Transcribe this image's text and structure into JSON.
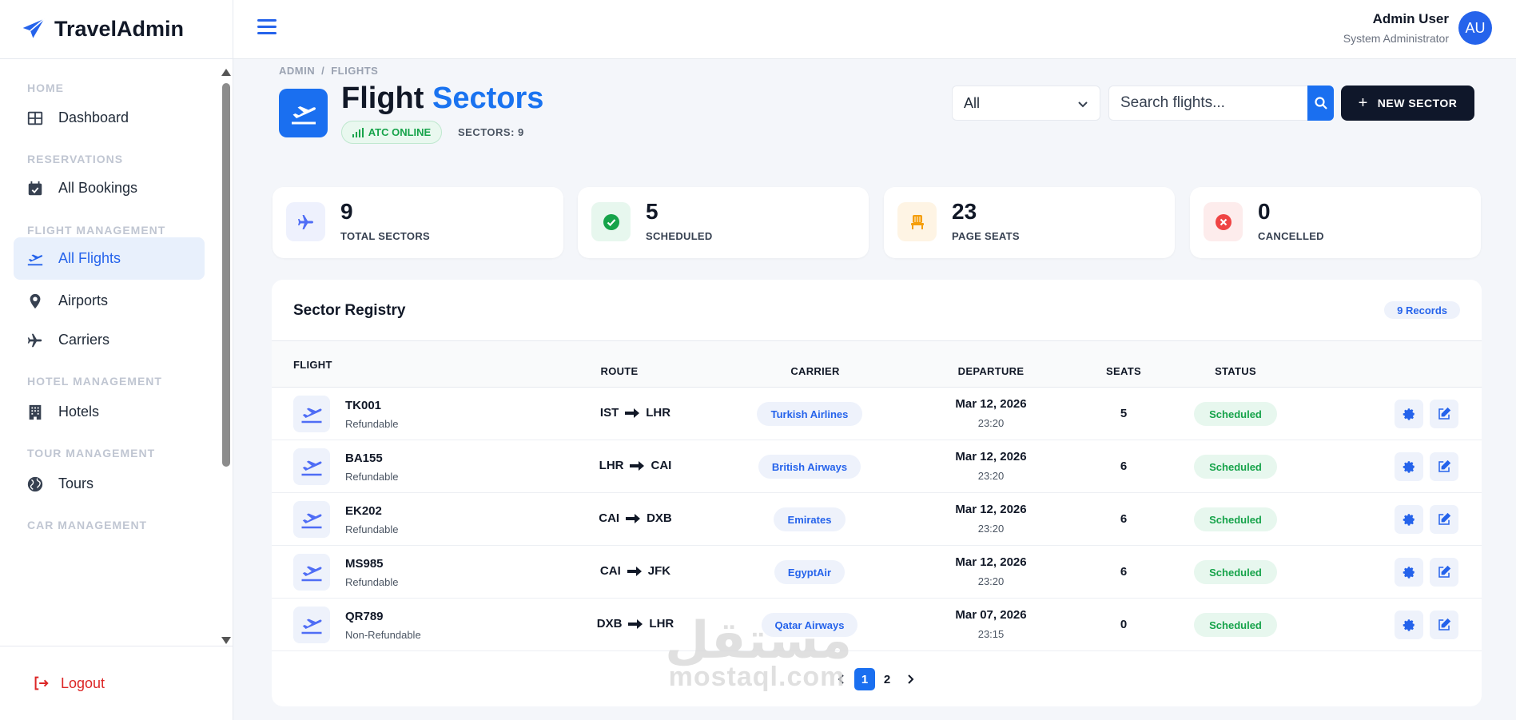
{
  "brand": {
    "name": "TravelAdmin"
  },
  "user": {
    "name": "Admin User",
    "role": "System Administrator",
    "initials": "AU"
  },
  "sidebar": {
    "sections": [
      {
        "label": "HOME"
      },
      {
        "label": "RESERVATIONS"
      },
      {
        "label": "FLIGHT MANAGEMENT"
      },
      {
        "label": "HOTEL MANAGEMENT"
      },
      {
        "label": "TOUR MANAGEMENT"
      },
      {
        "label": "CAR MANAGEMENT"
      }
    ],
    "items": [
      {
        "label": "Dashboard",
        "icon": "grid-icon"
      },
      {
        "label": "All Bookings",
        "icon": "calendar-check-icon"
      },
      {
        "label": "All Flights",
        "icon": "plane-departure-icon",
        "active": true
      },
      {
        "label": "Airports",
        "icon": "map-pin-icon"
      },
      {
        "label": "Carriers",
        "icon": "plane-icon"
      },
      {
        "label": "Hotels",
        "icon": "building-icon"
      },
      {
        "label": "Tours",
        "icon": "globe-icon"
      }
    ],
    "logout_label": "Logout"
  },
  "breadcrumb": {
    "root": "ADMIN",
    "sep": "/",
    "current": "FLIGHTS"
  },
  "page": {
    "title_main": "Flight",
    "title_accent": "Sectors",
    "atc_status": "ATC ONLINE",
    "sector_count": "SECTORS: 9"
  },
  "filter": {
    "selected": "All"
  },
  "search": {
    "placeholder": "Search flights..."
  },
  "new_button_label": "NEW SECTOR",
  "stats": [
    {
      "value": "9",
      "label": "TOTAL SECTORS",
      "icon": "plane-icon",
      "color": "#4f6df5"
    },
    {
      "value": "5",
      "label": "SCHEDULED",
      "icon": "check-circle-icon",
      "color": "#16a34a"
    },
    {
      "value": "23",
      "label": "PAGE SEATS",
      "icon": "seat-icon",
      "color": "#f59e0b"
    },
    {
      "value": "0",
      "label": "CANCELLED",
      "icon": "x-circle-icon",
      "color": "#ef4444"
    }
  ],
  "table": {
    "title": "Sector Registry",
    "records": "9 Records",
    "columns": [
      "FLIGHT",
      "ROUTE",
      "CARRIER",
      "DEPARTURE",
      "SEATS",
      "STATUS"
    ],
    "rows": [
      {
        "code": "TK001",
        "type": "Refundable",
        "from": "IST",
        "to": "LHR",
        "carrier": "Turkish Airlines",
        "date": "Mar 12, 2026",
        "time": "23:20",
        "seats": "5",
        "status": "Scheduled"
      },
      {
        "code": "BA155",
        "type": "Refundable",
        "from": "LHR",
        "to": "CAI",
        "carrier": "British Airways",
        "date": "Mar 12, 2026",
        "time": "23:20",
        "seats": "6",
        "status": "Scheduled"
      },
      {
        "code": "EK202",
        "type": "Refundable",
        "from": "CAI",
        "to": "DXB",
        "carrier": "Emirates",
        "date": "Mar 12, 2026",
        "time": "23:20",
        "seats": "6",
        "status": "Scheduled"
      },
      {
        "code": "MS985",
        "type": "Refundable",
        "from": "CAI",
        "to": "JFK",
        "carrier": "EgyptAir",
        "date": "Mar 12, 2026",
        "time": "23:20",
        "seats": "6",
        "status": "Scheduled"
      },
      {
        "code": "QR789",
        "type": "Non-Refundable",
        "from": "DXB",
        "to": "LHR",
        "carrier": "Qatar Airways",
        "date": "Mar 07, 2026",
        "time": "23:15",
        "seats": "0",
        "status": "Scheduled"
      }
    ]
  },
  "pagination": {
    "pages": [
      "1",
      "2"
    ],
    "current": "1"
  },
  "watermark": {
    "arabic": "مستقل",
    "latin": "mostaql.com"
  },
  "colors": {
    "primary": "#1a6ff0",
    "dark": "#0f172a",
    "success": "#16a34a",
    "danger": "#dc2626"
  }
}
